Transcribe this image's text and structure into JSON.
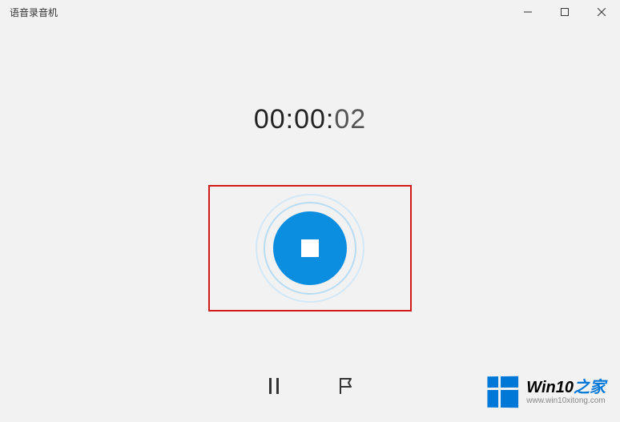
{
  "window": {
    "title": "语音录音机"
  },
  "timer": {
    "hours_minutes": "00:00:",
    "seconds": "02"
  },
  "controls": {
    "stop_label": "停止录制",
    "pause_label": "暂停",
    "flag_label": "添加标记"
  },
  "watermark": {
    "brand_prefix": "Win10",
    "brand_suffix": "之家",
    "url": "www.win10xitong.com"
  },
  "colors": {
    "accent": "#0c8ee0",
    "highlight_border": "#d11a1a",
    "win_blue": "#0078d7"
  }
}
